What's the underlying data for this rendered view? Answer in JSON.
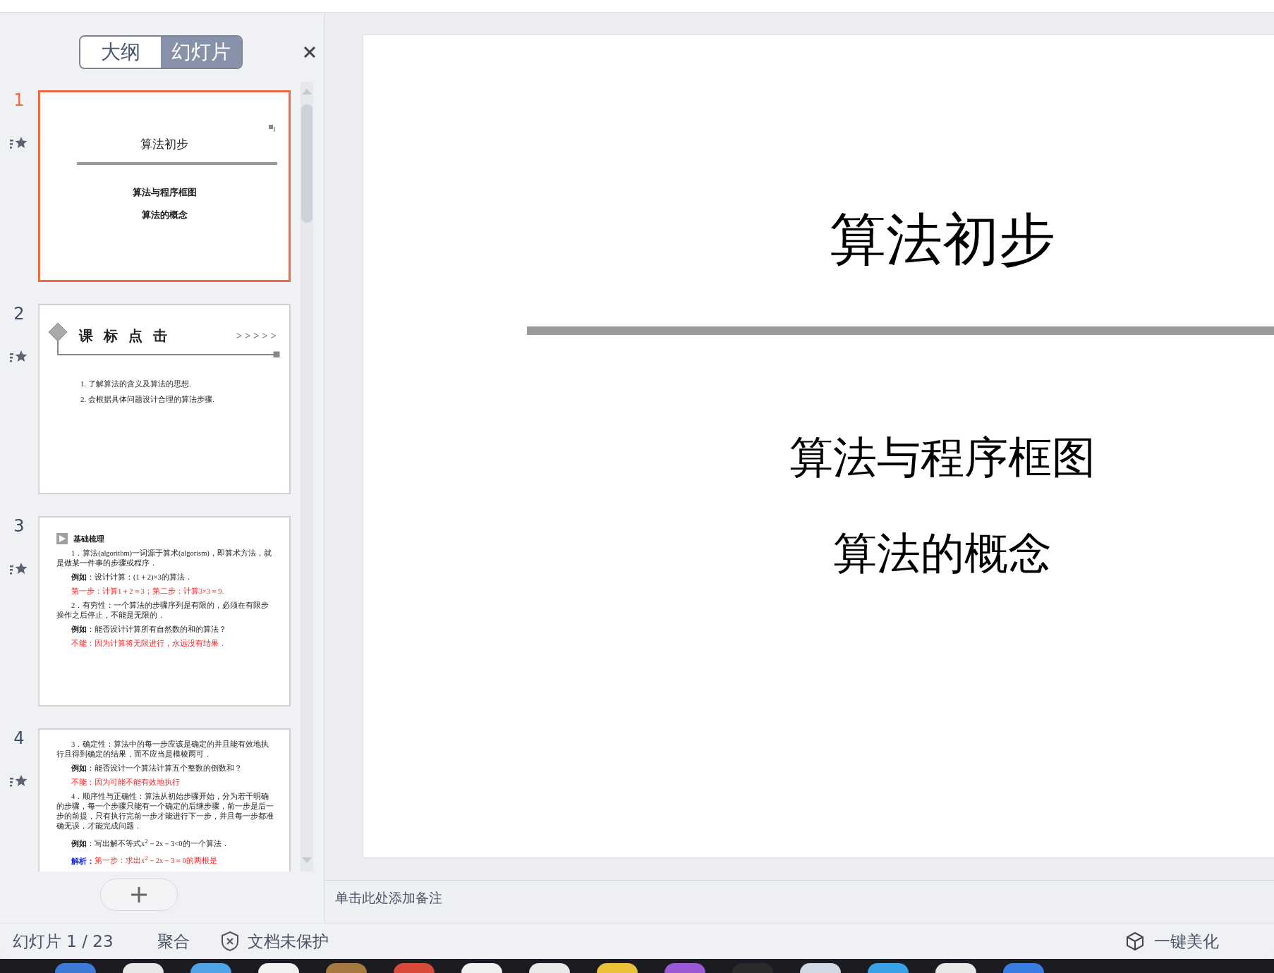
{
  "panel_tabs": [
    {
      "label": "大纲",
      "selected": false
    },
    {
      "label": "幻灯片",
      "selected": true
    }
  ],
  "thumbnails": [
    {
      "number": "1",
      "selected": true,
      "kind": "title",
      "title": "算法初步",
      "subtitles": [
        "算法与程序框图",
        "算法的概念"
      ]
    },
    {
      "number": "2",
      "selected": false,
      "kind": "objectives",
      "heading": "课 标 点 击",
      "arrows": "> > > > >",
      "items": [
        "1.  了解算法的含义及算法的思想.",
        "2.  会根据具体问题设计合理的算法步骤."
      ]
    },
    {
      "number": "3",
      "selected": false,
      "kind": "text",
      "heading": "基础梳理",
      "paragraphs": [
        {
          "kind": "body",
          "text": "1．算法(algorithm)一词源于算术(algorism)，即算术方法，就是做某一件事的步骤或程序．"
        },
        {
          "kind": "example",
          "text": "**例如**：设计计算：(1＋2)×3的算法．"
        },
        {
          "kind": "answer",
          "text": "第一步：计算1＋2＝3；第二步：计算3×3＝9."
        },
        {
          "kind": "body",
          "text": "2．有穷性：一个算法的步骤序列是有限的，必须在有限步操作之后停止，不能是无限的．"
        },
        {
          "kind": "example",
          "text": "**例如**：能否设计计算所有自然数的和的算法？"
        },
        {
          "kind": "answer",
          "text": "不能：因为计算将无限进行，永远没有结果．"
        }
      ]
    },
    {
      "number": "4",
      "selected": false,
      "kind": "text",
      "paragraphs": [
        {
          "kind": "body",
          "text": "3．确定性：算法中的每一步应该是确定的并且能有效地执行且得到确定的结果，而不应当是模棱两可．"
        },
        {
          "kind": "example",
          "text": "**例如**：能否设计一个算法计算五个整数的倒数和？"
        },
        {
          "kind": "answer",
          "text": "不能：因为可能不能有效地执行"
        },
        {
          "kind": "body",
          "text": "4．顺序性与正确性：算法从初始步骤开始，分为若干明确的步骤，每一个步骤只能有一个确定的后继步骤，前一步是后一步的前提，只有执行完前一步才能进行下一步，并且每一步都准确无误，才能完成问题．"
        },
        {
          "kind": "example",
          "text": "**例如**：写出解不等式x$^{2}$－2x－3<0的一个算法．"
        },
        {
          "kind": "analysis",
          "label": "解析：",
          "text": "第一步：求出x$^{2}$－2x－3＝0的两根是"
        }
      ]
    }
  ],
  "main_slide": {
    "title": "算法初步",
    "subtitles": [
      "算法与程序框图",
      "算法的概念"
    ]
  },
  "notes_placeholder": "单击此处添加备注",
  "status_bar": {
    "slide_counter": "幻灯片 1 / 23",
    "merge": "聚合",
    "protection": "文档未保护",
    "beautify": "一键美化"
  }
}
